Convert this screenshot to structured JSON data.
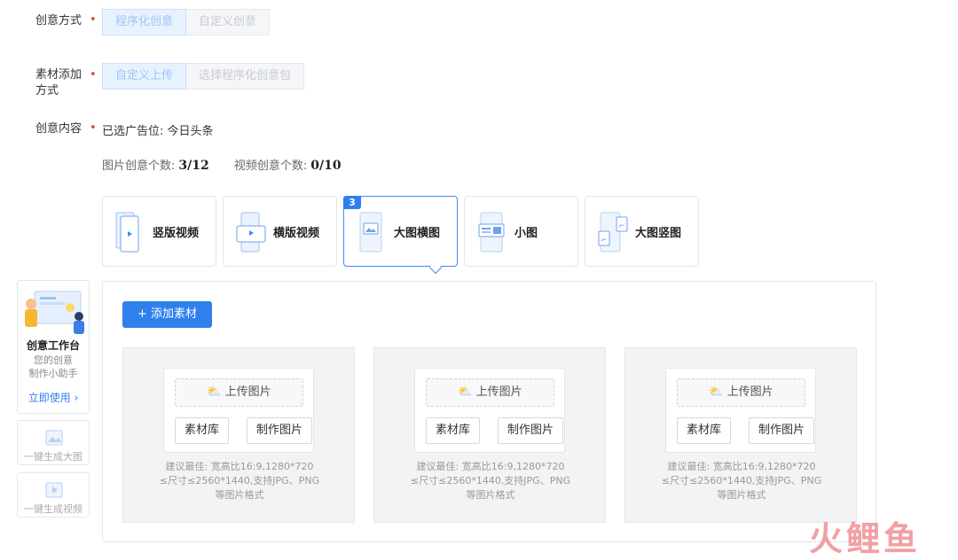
{
  "form": {
    "creative_mode": {
      "label": "创意方式",
      "options": [
        "程序化创意",
        "自定义创意"
      ],
      "selected": "程序化创意"
    },
    "material_add": {
      "label_line1": "素材添加",
      "label_line2": "方式",
      "options": [
        "自定义上传",
        "选择程序化创意包"
      ],
      "selected": "自定义上传"
    },
    "content": {
      "label": "创意内容",
      "placement_text": "已选广告位:  今日头条"
    },
    "required_mark": "•"
  },
  "counts": {
    "image_label": "图片创意个数:",
    "image_value": "3/12",
    "video_label": "视频创意个数:",
    "video_value": "0/10"
  },
  "types": [
    {
      "label": "竖版视频",
      "icon": "vertical-video-icon"
    },
    {
      "label": "横版视频",
      "icon": "horizontal-video-icon"
    },
    {
      "label": "大图横图",
      "icon": "large-horizontal-image-icon",
      "badge": "3",
      "selected": true
    },
    {
      "label": "小图",
      "icon": "small-image-icon"
    },
    {
      "label": "大图竖图",
      "icon": "large-vertical-image-icon"
    }
  ],
  "panel": {
    "add_label": "+ 添加素材",
    "slots": [
      {
        "upload": "上传图片",
        "library": "素材库",
        "make": "制作图片",
        "hint1": "建议最佳: 宽高比16:9,1280*720",
        "hint2": "≤尺寸≤2560*1440,支持JPG、PNG",
        "hint3": "等图片格式"
      },
      {
        "upload": "上传图片",
        "library": "素材库",
        "make": "制作图片",
        "hint1": "建议最佳: 宽高比16:9,1280*720",
        "hint2": "≤尺寸≤2560*1440,支持JPG、PNG",
        "hint3": "等图片格式"
      },
      {
        "upload": "上传图片",
        "library": "素材库",
        "make": "制作图片",
        "hint1": "建议最佳: 宽高比16:9,1280*720",
        "hint2": "≤尺寸≤2560*1440,支持JPG、PNG",
        "hint3": "等图片格式"
      }
    ]
  },
  "sidebar": {
    "title": "创意工作台",
    "desc1": "您的创意",
    "desc2": "制作小助手",
    "link": "立即使用 ›",
    "tool1": "一键生成大图",
    "tool2": "一键生成视频"
  },
  "watermark": "火鲤鱼",
  "colors": {
    "accent": "#2f80ed",
    "required": "#e8413a",
    "selected_border": "#3d8bf2"
  }
}
